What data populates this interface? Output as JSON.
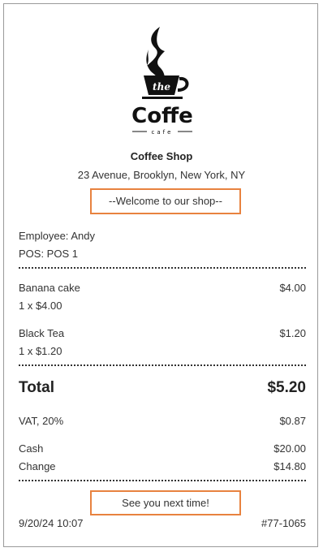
{
  "logo": {
    "word": "Coffe",
    "badge": "the",
    "tagline": "cafe"
  },
  "shop": {
    "name": "Coffee Shop",
    "address": "23 Avenue, Brooklyn, New York, NY",
    "welcome": "--Welcome to our shop--"
  },
  "meta": {
    "employee": "Employee: Andy",
    "pos": "POS: POS 1"
  },
  "items": [
    {
      "name": "Banana cake",
      "price": "$4.00",
      "detail": "1 x $4.00"
    },
    {
      "name": "Black Tea",
      "price": "$1.20",
      "detail": "1 x $1.20"
    }
  ],
  "totals": {
    "total_label": "Total",
    "total_value": "$5.20",
    "vat_label": "VAT, 20%",
    "vat_value": "$0.87",
    "cash_label": "Cash",
    "cash_value": "$20.00",
    "change_label": "Change",
    "change_value": "$14.80"
  },
  "footer": {
    "message": "See you next time!",
    "datetime": "9/20/24 10:07",
    "receipt_no": "#77-1065"
  },
  "colors": {
    "highlight_border": "#e8823f",
    "text": "#333333"
  }
}
